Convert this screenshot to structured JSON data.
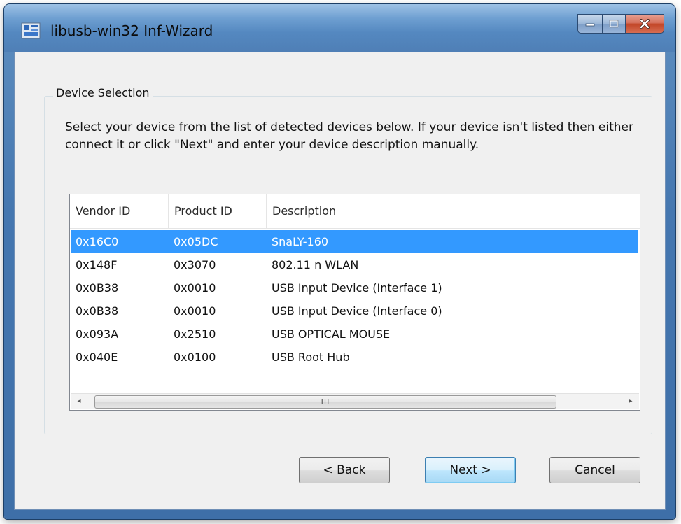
{
  "window": {
    "title": "libusb-win32 Inf-Wizard",
    "icons": {
      "app": "usb-app-icon",
      "minimize": "minimize-icon",
      "maximize": "maximize-icon",
      "close": "close-icon"
    }
  },
  "group": {
    "label": "Device Selection",
    "instructions": "Select your device from the list of detected devices below. If your device isn't listed then either connect it or click \"Next\" and enter your device description manually."
  },
  "devices": {
    "columns": [
      "Vendor ID",
      "Product ID",
      "Description"
    ],
    "rows": [
      [
        "0x16C0",
        "0x05DC",
        "SnaLY-160"
      ],
      [
        "0x148F",
        "0x3070",
        "802.11 n WLAN"
      ],
      [
        "0x0B38",
        "0x0010",
        "USB Input Device (Interface 1)"
      ],
      [
        "0x0B38",
        "0x0010",
        "USB Input Device (Interface 0)"
      ],
      [
        "0x093A",
        "0x2510",
        "USB OPTICAL MOUSE"
      ],
      [
        "0x040E",
        "0x0100",
        "USB Root Hub"
      ]
    ],
    "selected_row": 0,
    "scroll": {
      "left": "◂",
      "thumb": "III",
      "right": "▸"
    }
  },
  "buttons": {
    "back": "< Back",
    "next": "Next >",
    "cancel": "Cancel"
  },
  "colors": {
    "selection": "#3399ff",
    "titlebar": "#6e9fd1",
    "close": "#c24628"
  }
}
